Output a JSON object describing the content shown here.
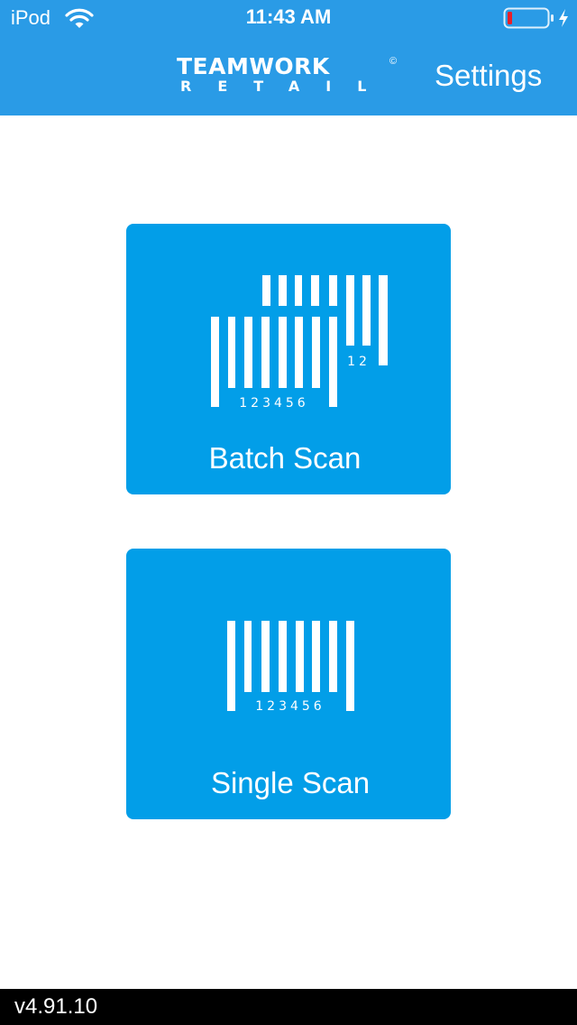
{
  "status_bar": {
    "carrier": "iPod",
    "time": "11:43 AM",
    "icons": [
      "wifi-icon",
      "battery-low-icon",
      "charging-bolt-icon"
    ]
  },
  "header": {
    "logo_top": "TEAMWORK",
    "logo_copyright": "©",
    "logo_bottom": "RETAIL",
    "settings_label": "Settings",
    "background_color": "#2a9be6"
  },
  "tiles": {
    "batch": {
      "label": "Batch Scan",
      "icon": "batch-barcode-icon",
      "front_barcode_digits": "123456",
      "back_barcode_digits": "12"
    },
    "single": {
      "label": "Single Scan",
      "icon": "single-barcode-icon",
      "barcode_digits": "123456"
    },
    "tile_color": "#029ee8"
  },
  "footer": {
    "version": "v4.91.10"
  },
  "colors": {
    "battery_low": "#e8202a",
    "text_light": "#ffffff"
  }
}
